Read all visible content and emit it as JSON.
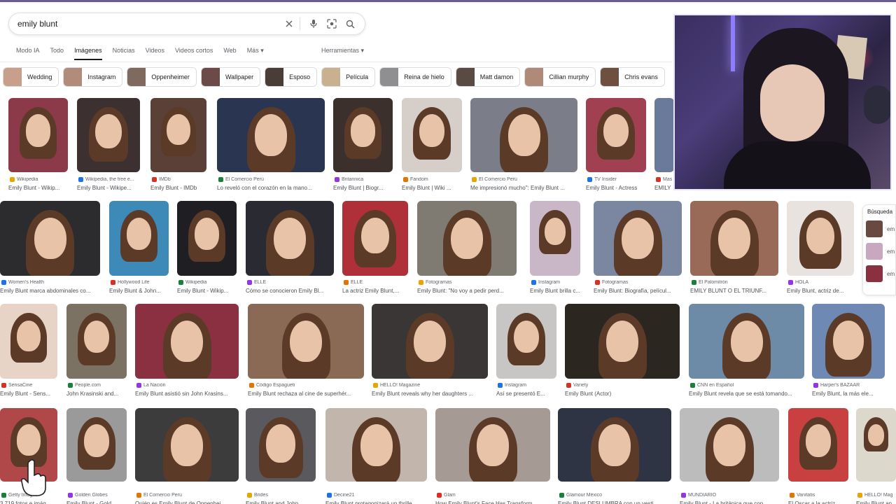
{
  "search": {
    "query": "emily blunt"
  },
  "tabs": [
    "Modo IA",
    "Todo",
    "Imágenes",
    "Noticias",
    "Videos",
    "Videos cortos",
    "Web",
    "Más"
  ],
  "tools_label": "Herramientas",
  "chips": [
    "Wedding",
    "Instagram",
    "Oppenheimer",
    "Wallpaper",
    "Esposo",
    "Película",
    "Reina de hielo",
    "Matt damon",
    "Cillian murphy",
    "Chris evans"
  ],
  "rows": [
    [
      {
        "source": "Wikipedia",
        "title": "Emily Blunt - Wikip..."
      },
      {
        "source": "Wikipedia, the free e...",
        "title": "Emily Blunt - Wikipe..."
      },
      {
        "source": "IMDb",
        "title": "Emily Blunt - IMDb"
      },
      {
        "source": "El Comercio Perú",
        "title": "Lo reveló con el corazón en la mano..."
      },
      {
        "source": "Britannica",
        "title": "Emily Blunt | Biogr..."
      },
      {
        "source": "Fandom",
        "title": "Emily Blunt | Wiki ..."
      },
      {
        "source": "El Comercio Perú",
        "title": "Me impresionó mucho\": Emily Blunt ..."
      },
      {
        "source": "TV Insider",
        "title": "Emily Blunt - Actress"
      },
      {
        "source": "Mas",
        "title": "EMILY"
      }
    ],
    [
      {
        "source": "Women's Health",
        "title": "Emily Blunt marca abdominales co..."
      },
      {
        "source": "Hollywood Life",
        "title": "Emily Blunt & John..."
      },
      {
        "source": "Wikipedia",
        "title": "Emily Blunt - Wikip..."
      },
      {
        "source": "ELLE",
        "title": "Cómo se conocieron Emily Bl..."
      },
      {
        "source": "ELLE",
        "title": "La actriz Emily Blunt,..."
      },
      {
        "source": "Fotogramas",
        "title": "Emily Blunt: \"No voy a pedir perd..."
      },
      {
        "source": "Instagram",
        "title": "Emily Blunt brilla c..."
      },
      {
        "source": "Fotogramas",
        "title": "Emily Blunt: Biografía, películ..."
      },
      {
        "source": "El Palomitrón",
        "title": "EMILY BLUNT O EL TRIUNF..."
      },
      {
        "source": "HOLA",
        "title": "Emily Blunt, actriz de..."
      }
    ],
    [
      {
        "source": "SensaCine",
        "title": "Emily Blunt - Sens..."
      },
      {
        "source": "People.com",
        "title": "John Krasinski and..."
      },
      {
        "source": "La Nación",
        "title": "Emily Blunt asistió sin John Krasins..."
      },
      {
        "source": "Código Espagueti",
        "title": "Emily Blunt rechaza al cine de superhér..."
      },
      {
        "source": "HELLO! Magazine",
        "title": "Emily Blunt reveals why her daughters ..."
      },
      {
        "source": "Instagram",
        "title": "Así se presentó E..."
      },
      {
        "source": "Variety",
        "title": "Emily Blunt (Actor)"
      },
      {
        "source": "CNN en Español",
        "title": "Emily Blunt revela que se está tomando..."
      },
      {
        "source": "Harper's BAZAAR",
        "title": "Emily Blunt, la más ele..."
      }
    ],
    [
      {
        "source": "Getty Images",
        "title": "3.719 fotos e imág..."
      },
      {
        "source": "Golden Globes",
        "title": "Emily Blunt - Gold..."
      },
      {
        "source": "El Comercio Perú",
        "title": "Quién es Emily Blunt de Oppenhei..."
      },
      {
        "source": "Brides",
        "title": "Emily Blunt and John ..."
      },
      {
        "source": "Decine21",
        "title": "Emily Blunt protagonizará un thrille..."
      },
      {
        "source": "Glam",
        "title": "How Emily Blunt's Face Has Transform..."
      },
      {
        "source": "Glamour México",
        "title": "Emily Blunt DESLUMBRA con un vesti..."
      },
      {
        "source": "MUNDIARIO",
        "title": "Emily Blunt - La británica que con..."
      },
      {
        "source": "Vanitatis",
        "title": "El Oscar a la actriz..."
      },
      {
        "source": "HELLO! Mag",
        "title": "Emily Blunt an"
      }
    ]
  ],
  "side_panel": {
    "title": "Búsqueda",
    "items": [
      "em",
      "em",
      "em"
    ]
  }
}
